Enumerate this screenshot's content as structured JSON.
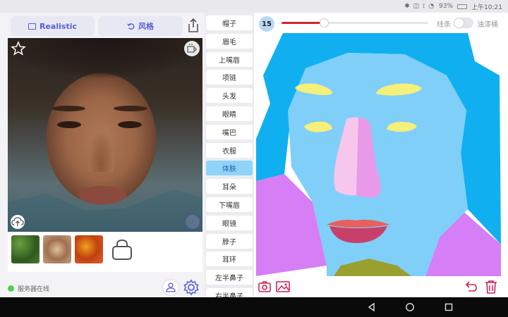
{
  "status_bar": {
    "indicators": "✱ ◫ ⟟ ◔",
    "battery": "93%",
    "time": "上午10:21"
  },
  "left": {
    "mode_realistic": "Realistic",
    "mode_style": "风格",
    "server_status": "服务器在线",
    "info_glyph": "i"
  },
  "categories": [
    {
      "label": "帽子",
      "active": false
    },
    {
      "label": "眉毛",
      "active": false
    },
    {
      "label": "上嘴唇",
      "active": false
    },
    {
      "label": "项链",
      "active": false
    },
    {
      "label": "头发",
      "active": false
    },
    {
      "label": "眼睛",
      "active": false
    },
    {
      "label": "嘴巴",
      "active": false
    },
    {
      "label": "衣服",
      "active": false
    },
    {
      "label": "体肤",
      "active": true
    },
    {
      "label": "耳朵",
      "active": false
    },
    {
      "label": "下嘴唇",
      "active": false
    },
    {
      "label": "眼镜",
      "active": false
    },
    {
      "label": "脖子",
      "active": false
    },
    {
      "label": "耳环",
      "active": false
    },
    {
      "label": "左半鼻子",
      "active": false
    },
    {
      "label": "右半鼻子",
      "active": false
    }
  ],
  "brush": {
    "size": "15",
    "slider_fraction": 0.29,
    "label_lines": "线条",
    "label_bucket": "油漆桶",
    "bucket_enabled": false
  },
  "colors": {
    "accent": "#5b5fd6",
    "slider": "#d0262e",
    "active_category": "#8fd3f9",
    "hair_segment": "#10b0f0",
    "skin_segment": "#80cff8",
    "cloth_segment": "#d57ef5",
    "brow_segment": "#f5f07a",
    "nose_left": "#f6c6ec",
    "nose_right": "#e89ae8",
    "lips_upper": "#e8605e",
    "lips_lower": "#c8406a",
    "neck_segment": "#9aa030",
    "tool_red": "#d02050",
    "server_online": "#4ad04a"
  },
  "icons": {
    "mode_realistic": "image-icon",
    "mode_style": "undo-style-icon",
    "share": "share-icon",
    "favorite": "star-icon",
    "coffee": "cup-icon",
    "upload": "cloud-upload-icon",
    "info": "info-icon",
    "bag": "bag-icon",
    "user": "user-icon",
    "settings": "gear-icon",
    "camera": "camera-icon",
    "gallery": "image-icon",
    "undo": "undo-icon",
    "delete": "trash-icon"
  }
}
